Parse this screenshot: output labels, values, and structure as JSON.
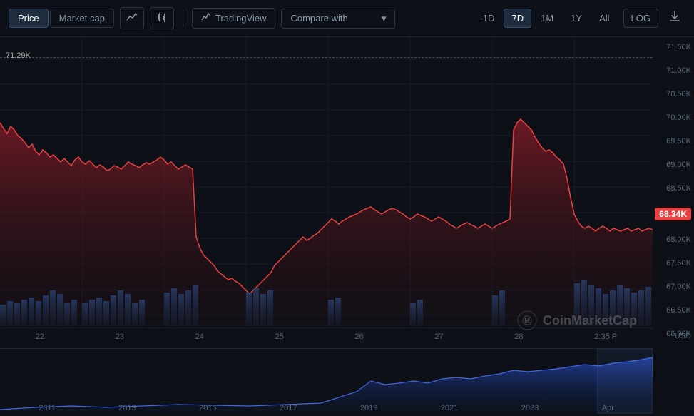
{
  "toolbar": {
    "price_label": "Price",
    "market_cap_label": "Market cap",
    "line_icon": "〜",
    "candle_icon": "⬛",
    "tradingview_label": "TradingView",
    "compare_label": "Compare with",
    "compare_chevron": "▾",
    "timeframes": [
      "1D",
      "7D",
      "1M",
      "1Y",
      "All"
    ],
    "active_timeframe": "7D",
    "log_label": "LOG",
    "download_icon": "⬇"
  },
  "chart": {
    "max_label": "71.29K",
    "price_badge": "68.34K",
    "y_axis": [
      "71.50K",
      "71.00K",
      "70.50K",
      "70.00K",
      "69.50K",
      "69.00K",
      "68.50K",
      "68.00K",
      "67.50K",
      "67.00K",
      "66.50K",
      "66.00K"
    ],
    "x_axis_dates": [
      "22",
      "23",
      "24",
      "25",
      "26",
      "27",
      "28",
      "2:35 P"
    ],
    "usd_label": "USD",
    "watermark_logo": "Ⓜ",
    "watermark_text": "CoinMarketCap",
    "mini_x_axis": [
      "2011",
      "2013",
      "2015",
      "2017",
      "2019",
      "2021",
      "2023",
      "Apr"
    ]
  }
}
